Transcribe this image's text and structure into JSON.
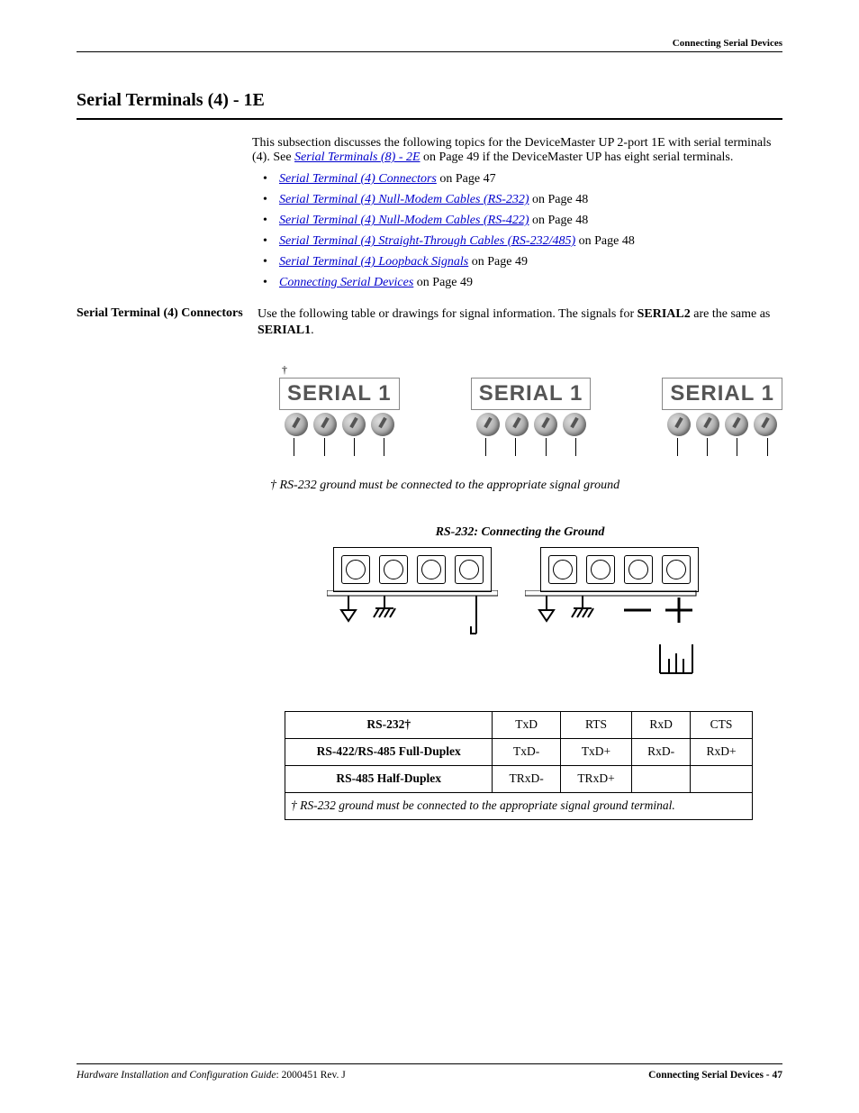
{
  "header": {
    "right": "Connecting Serial Devices"
  },
  "section_title": "Serial Terminals (4) - 1E",
  "intro": {
    "p1_a": "This subsection discusses the following topics for the DeviceMaster UP 2-port 1E with serial terminals (4). See ",
    "p1_link": "Serial Terminals (8) - 2E",
    "p1_b": " on Page 49 if the DeviceMaster UP has eight serial terminals."
  },
  "bullets": [
    {
      "link": "Serial Terminal (4) Connectors",
      "tail": " on Page 47"
    },
    {
      "link": "Serial Terminal (4) Null-Modem Cables (RS-232)",
      "tail": " on Page 48"
    },
    {
      "link": "Serial Terminal (4) Null-Modem Cables (RS-422)",
      "tail": " on Page 48"
    },
    {
      "link": "Serial Terminal (4) Straight-Through Cables (RS-232/485)",
      "tail": " on Page 48"
    },
    {
      "link": "Serial Terminal (4) Loopback Signals",
      "tail": " on Page 49"
    },
    {
      "link": "Connecting Serial Devices",
      "tail": " on Page 49"
    }
  ],
  "subhead": "Serial Terminal (4) Connectors",
  "subtext_a": "Use the following table or drawings for signal information. The signals for ",
  "subtext_b": "SERIAL2",
  "subtext_c": " are the same as ",
  "subtext_d": "SERIAL1",
  "subtext_e": ".",
  "dagger": "†",
  "serial_label": "SERIAL 1",
  "footnote_top": "† RS-232 ground must be connected to the appropriate signal ground",
  "figure_title": "RS-232: Connecting the Ground",
  "table": {
    "rows": [
      [
        "RS-232†",
        "TxD",
        "RTS",
        "RxD",
        "CTS"
      ],
      [
        "RS-422/RS-485 Full-Duplex",
        "TxD-",
        "TxD+",
        "RxD-",
        "RxD+"
      ],
      [
        "RS-485 Half-Duplex",
        "TRxD-",
        "TRxD+",
        "",
        ""
      ]
    ],
    "foot_a": "† ",
    "foot_b": "RS-232 ground must be connected to the appropriate signal ground terminal."
  },
  "footer": {
    "left_a": "Hardware Installation and Configuration Guide",
    "left_b": ": 2000451 Rev. J",
    "right": "Connecting Serial Devices - 47"
  }
}
